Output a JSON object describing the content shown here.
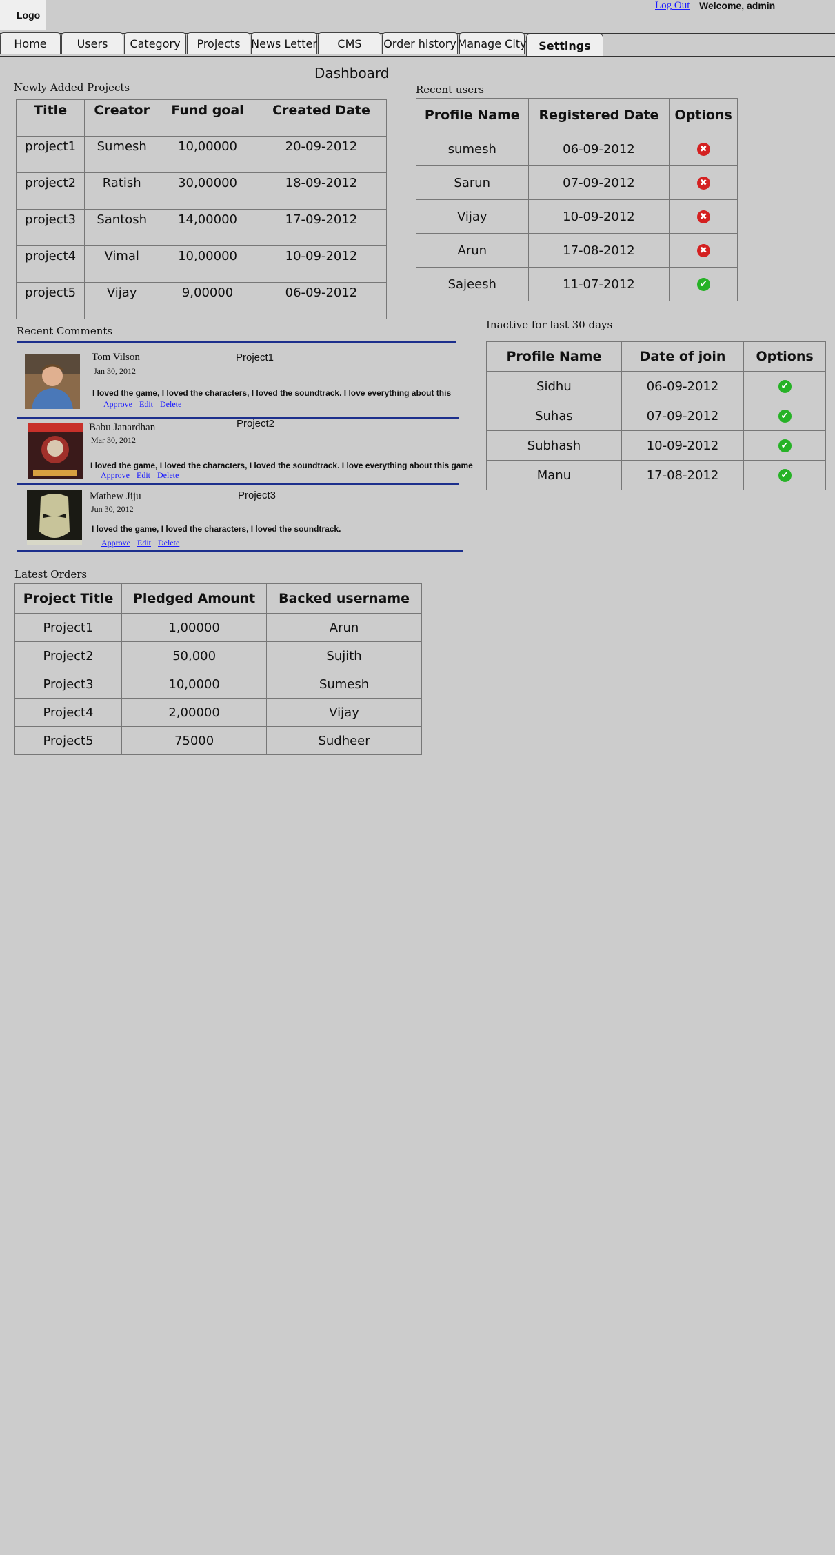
{
  "header": {
    "logo": "Logo",
    "logout_label": "Log Out",
    "welcome": "Welcome, admin"
  },
  "nav": {
    "tabs": [
      "Home",
      "Users",
      "Category",
      "Projects",
      "News Letter",
      "CMS",
      "Order history",
      "Manage City",
      "Settings"
    ],
    "active": "Settings"
  },
  "dashboard": {
    "title": "Dashboard"
  },
  "new_projects": {
    "title": "Newly Added Projects",
    "columns": [
      "Title",
      "Creator",
      "Fund goal",
      "Created Date"
    ],
    "rows": [
      [
        "project1",
        "Sumesh",
        "10,00000",
        "20-09-2012"
      ],
      [
        "project2",
        "Ratish",
        "30,00000",
        "18-09-2012"
      ],
      [
        "project3",
        "Santosh",
        "14,00000",
        "17-09-2012"
      ],
      [
        "project4",
        "Vimal",
        "10,00000",
        "10-09-2012"
      ],
      [
        "project5",
        "Vijay",
        "9,00000",
        "06-09-2012"
      ]
    ]
  },
  "recent_users": {
    "title": "Recent users",
    "columns": [
      "Profile Name",
      "Registered Date",
      "Options"
    ],
    "rows": [
      {
        "name": "sumesh",
        "date": "06-09-2012",
        "status": "reject"
      },
      {
        "name": "Sarun",
        "date": "07-09-2012",
        "status": "reject"
      },
      {
        "name": "Vijay",
        "date": "10-09-2012",
        "status": "reject"
      },
      {
        "name": "Arun",
        "date": "17-08-2012",
        "status": "reject"
      },
      {
        "name": "Sajeesh",
        "date": "11-07-2012",
        "status": "approve"
      }
    ]
  },
  "recent_comments": {
    "title": "Recent Comments",
    "items": [
      {
        "author": "Tom Vilson",
        "date": "Jan 30, 2012",
        "project": "Project1",
        "text": "I loved the game, I loved the characters, I loved the soundtrack. I love everything about this",
        "avatar": "person-photo"
      },
      {
        "author": "Babu Janardhan",
        "date": "Mar 30, 2012",
        "project": "Project2",
        "text": "I loved the game, I loved the characters, I loved the soundtrack. I love everything about this game",
        "avatar": "kickstarter-art"
      },
      {
        "author": "Mathew Jiju",
        "date": "Jun 30, 2012",
        "project": "Project3",
        "text": "I loved the game, I loved the characters, I loved the soundtrack.",
        "avatar": "game-character-art"
      }
    ],
    "actions": [
      "Approve",
      "Edit",
      "Delete"
    ]
  },
  "inactive_users": {
    "title": "Inactive for last 30 days",
    "columns": [
      "Profile Name",
      "Date of join",
      "Options"
    ],
    "rows": [
      {
        "name": "Sidhu",
        "date": "06-09-2012",
        "status": "approve"
      },
      {
        "name": "Suhas",
        "date": "07-09-2012",
        "status": "approve"
      },
      {
        "name": "Subhash",
        "date": "10-09-2012",
        "status": "approve"
      },
      {
        "name": "Manu",
        "date": "17-08-2012",
        "status": "approve"
      }
    ]
  },
  "latest_orders": {
    "title": "Latest Orders",
    "columns": [
      "Project Title",
      "Pledged Amount",
      "Backed username"
    ],
    "rows": [
      [
        "Project1",
        "1,00000",
        "Arun"
      ],
      [
        "Project2",
        "50,000",
        "Sujith"
      ],
      [
        "Project3",
        "10,0000",
        "Sumesh"
      ],
      [
        "Project4",
        "2,00000",
        "Vijay"
      ],
      [
        "Project5",
        "75000",
        "Sudheer"
      ]
    ]
  },
  "colors": {
    "background": "#cccccc",
    "reject": "#d42020",
    "approve": "#26b226",
    "link": "#1a1aff",
    "divider": "#1c2f8c"
  }
}
